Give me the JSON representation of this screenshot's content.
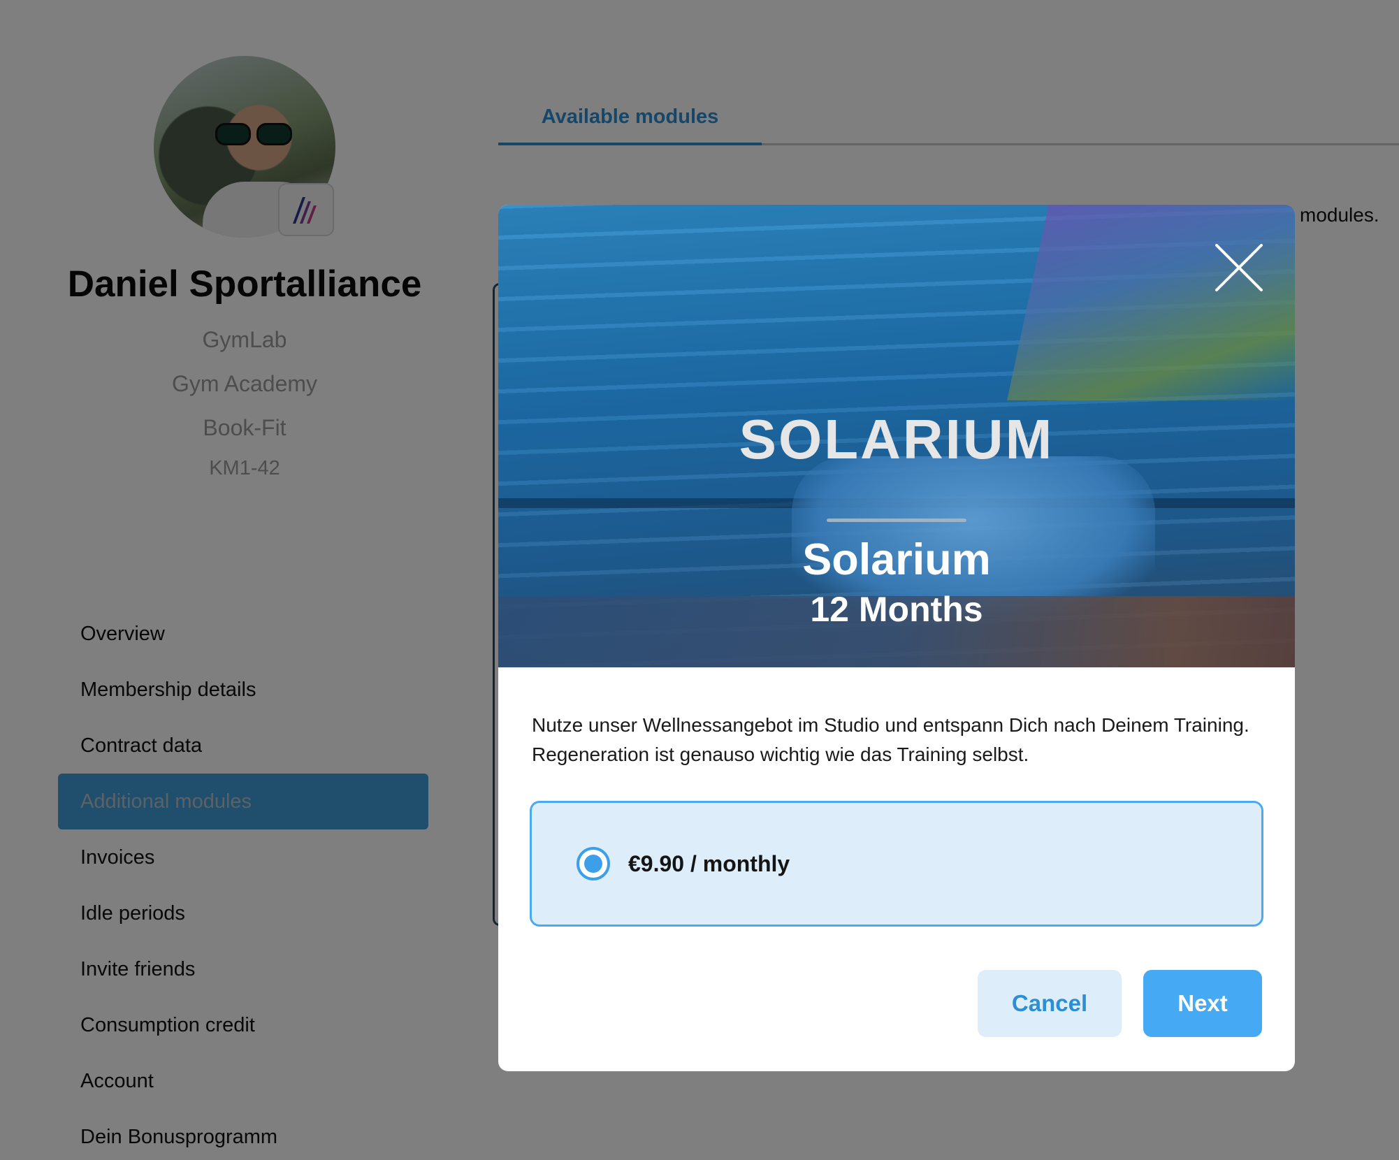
{
  "profile": {
    "name": "Daniel Sportalliance",
    "lines": [
      "GymLab",
      "Gym Academy",
      "Book-Fit",
      "KM1-42"
    ]
  },
  "sidebar": {
    "items": [
      {
        "label": "Overview"
      },
      {
        "label": "Membership details"
      },
      {
        "label": "Contract data"
      },
      {
        "label": "Additional modules",
        "active": true
      },
      {
        "label": "Invoices"
      },
      {
        "label": "Idle periods"
      },
      {
        "label": "Invite friends"
      },
      {
        "label": "Consumption credit"
      },
      {
        "label": "Account"
      },
      {
        "label": "Dein Bonusprogramm"
      }
    ]
  },
  "tabs": {
    "active_label": "Available modules"
  },
  "background": {
    "partial_text": "modules."
  },
  "modal": {
    "hero_logo": "SOLARIUM",
    "title": "Solarium",
    "subtitle": "12 Months",
    "close_icon": "close-icon",
    "description": "Nutze unser Wellnessangebot im Studio und entspann Dich nach Deinem Training. Regeneration ist genauso wichtig wie das Training selbst.",
    "option": {
      "label": "€9.90 / monthly",
      "selected": true
    },
    "cancel_label": "Cancel",
    "next_label": "Next"
  },
  "colors": {
    "accent": "#2d8fd3",
    "primary_button": "#45a9f3",
    "option_bg": "#ddeefa",
    "overlay": "rgba(0,0,0,0.5)"
  }
}
